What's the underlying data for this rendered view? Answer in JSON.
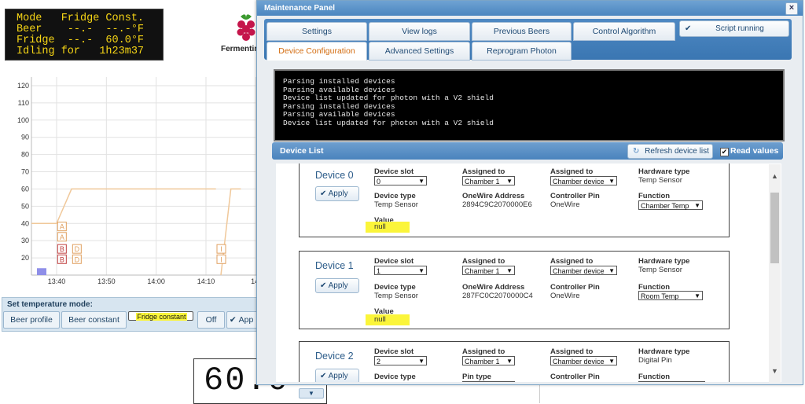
{
  "lcd": {
    "rows": [
      "Mode   Fridge Const.",
      "Beer    --.-  --.-°F",
      "Fridge  --.-  60.0°F",
      "Idling for   1h23m37"
    ]
  },
  "brand": {
    "text": "Fermentin"
  },
  "chart_data": {
    "type": "line",
    "title": "",
    "x_tick_labels": [
      "13:40",
      "13:50",
      "14:00",
      "14:10",
      "14:"
    ],
    "y_tick_labels": [
      "20",
      "30",
      "40",
      "50",
      "60",
      "70",
      "80",
      "90",
      "100",
      "110",
      "120"
    ],
    "ylim": [
      10,
      125
    ],
    "series": [
      {
        "color": "#f0c89a",
        "points": [
          [
            "13:33",
            40
          ],
          [
            "13:40",
            40
          ],
          [
            "13:43",
            60
          ],
          [
            "14:12",
            60
          ]
        ]
      },
      {
        "color": "#f0c89a",
        "points": [
          [
            "14:13",
            10
          ],
          [
            "14:15",
            60
          ],
          [
            "14:17",
            60
          ]
        ]
      }
    ],
    "annotations": [
      {
        "text": "A",
        "x": "13:41",
        "y": 38,
        "color": "#e0a060"
      },
      {
        "text": "A",
        "x": "13:41",
        "y": 32,
        "color": "#e0a060"
      },
      {
        "text": "B",
        "x": "13:41",
        "y": 25,
        "color": "#c04040"
      },
      {
        "text": "D",
        "x": "13:44",
        "y": 25,
        "color": "#e0a060"
      },
      {
        "text": "B",
        "x": "13:41",
        "y": 19,
        "color": "#c04040"
      },
      {
        "text": "D",
        "x": "13:44",
        "y": 19,
        "color": "#e0a060"
      },
      {
        "text": "I",
        "x": "14:13",
        "y": 25,
        "color": "#e0a060"
      },
      {
        "text": "I",
        "x": "14:13",
        "y": 19,
        "color": "#e0a060"
      }
    ],
    "bar": {
      "x": "13:37",
      "value": 14,
      "color": "#8f8fe8"
    },
    "grid": true
  },
  "temp_mode": {
    "title": "Set temperature mode:",
    "buttons": [
      "Beer profile",
      "Beer constant",
      "Fridge constant",
      "Off",
      "App"
    ],
    "selected": "Fridge constant"
  },
  "big_temp": {
    "value": "60.0"
  },
  "dialog": {
    "title": "Maintenance Panel",
    "close": "×",
    "tabs_row1": [
      "Settings",
      "View logs",
      "Previous Beers",
      "Control Algorithm"
    ],
    "tabs_row2": [
      "Device Configuration",
      "Advanced Settings",
      "Reprogram Photon"
    ],
    "active_tab": "Device Configuration",
    "script_status": "Script running",
    "console_lines": [
      "Parsing installed devices",
      "Parsing available devices",
      "Device list updated for photon with a V2 shield",
      "Parsing installed devices",
      "Parsing available devices",
      "Device list updated for photon with a V2 shield"
    ],
    "device_list": {
      "title": "Device List",
      "refresh_label": "Refresh device list",
      "read_values_label": "Read values",
      "read_values_checked": true
    },
    "labels": {
      "slot": "Device slot",
      "assigned": "Assigned to",
      "hw": "Hardware type",
      "dtype": "Device type",
      "onewire": "OneWire Address",
      "pin": "Controller Pin",
      "function": "Function",
      "value": "Value",
      "pin_type": "Pin type",
      "apply": "Apply"
    },
    "devices": [
      {
        "name": "Device 0",
        "slot": "0",
        "assigned": "Chamber 1",
        "assigned2": "Chamber device",
        "hw": "Temp Sensor",
        "dtype": "Temp Sensor",
        "onewire": "2894C9C2070000E6",
        "pin": "OneWire",
        "function": "Chamber Temp",
        "value": "null"
      },
      {
        "name": "Device 1",
        "slot": "1",
        "assigned": "Chamber 1",
        "assigned2": "Chamber device",
        "hw": "Temp Sensor",
        "dtype": "Temp Sensor",
        "onewire": "287FC0C2070000C4",
        "pin": "OneWire",
        "function": "Room Temp",
        "value": "null"
      },
      {
        "name": "Device 2",
        "slot": "2",
        "assigned": "Chamber 1",
        "assigned2": "Chamber device",
        "hw": "Digital Pin"
      }
    ]
  }
}
